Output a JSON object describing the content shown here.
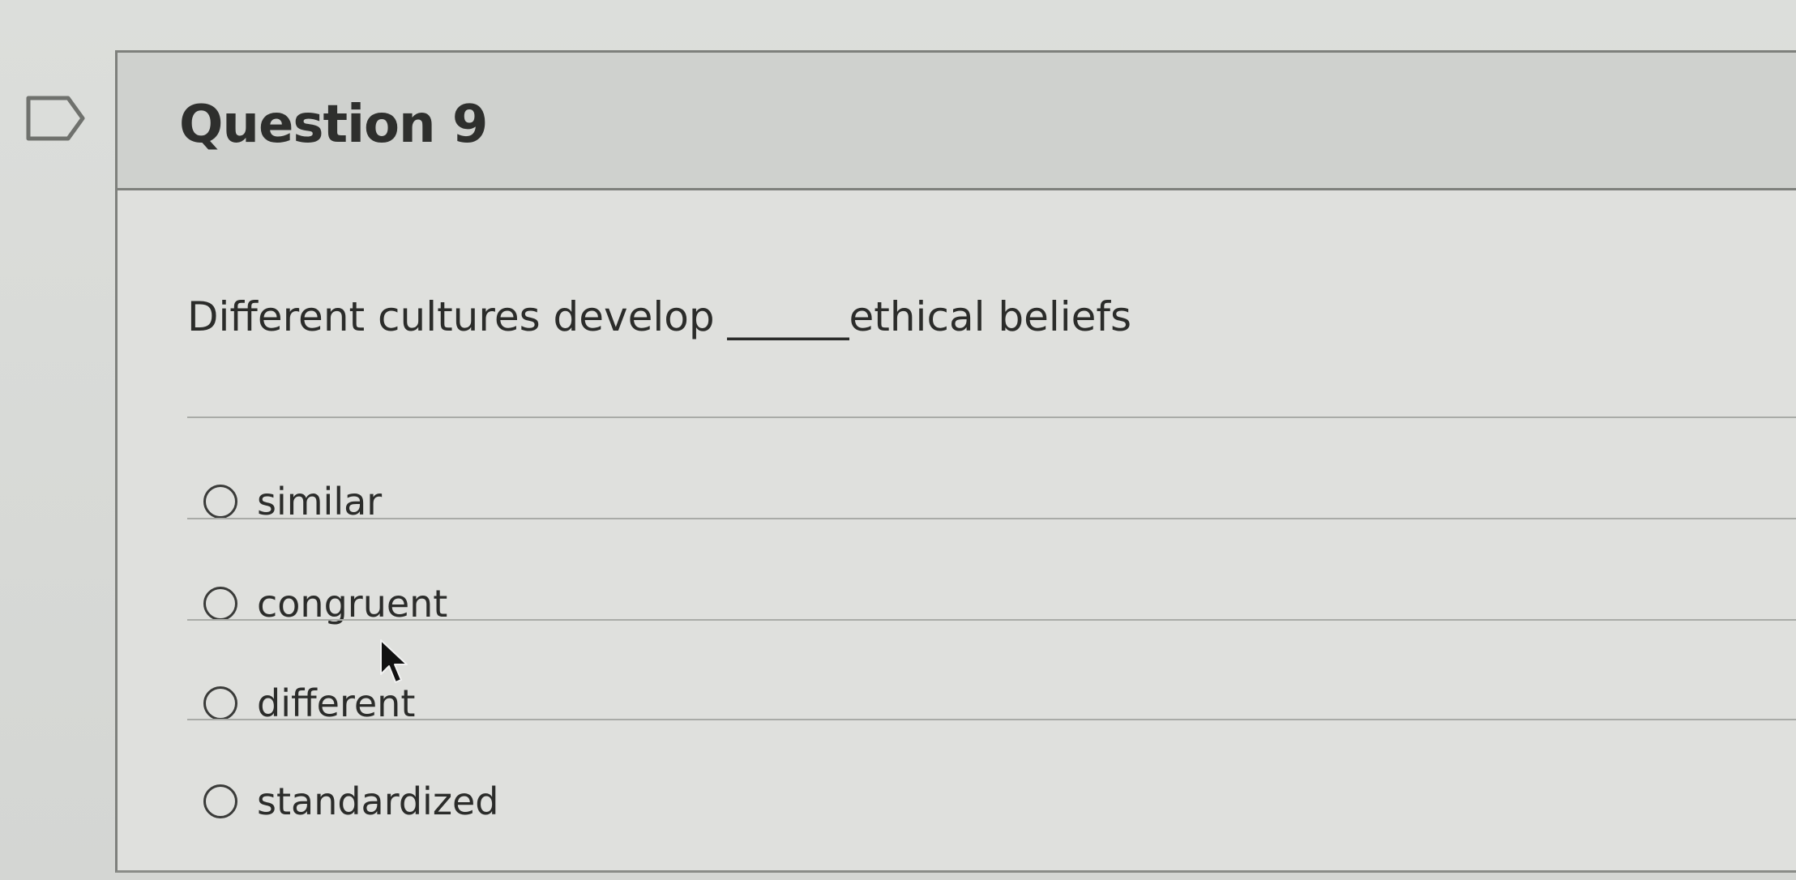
{
  "question": {
    "title": "Question 9",
    "text": "Different cultures develop ______ethical beliefs"
  },
  "options": [
    {
      "label": "similar",
      "selected": false
    },
    {
      "label": "congruent",
      "selected": false
    },
    {
      "label": "different",
      "selected": false
    },
    {
      "label": "standardized",
      "selected": false
    }
  ],
  "icons": {
    "flag": "flag-question-icon",
    "cursor": "mouse-pointer-icon"
  },
  "colors": {
    "header_bg": "#cfd1ce",
    "body_bg": "#dfe0dd",
    "text": "#2b2c2a",
    "border": "#7e807c"
  }
}
